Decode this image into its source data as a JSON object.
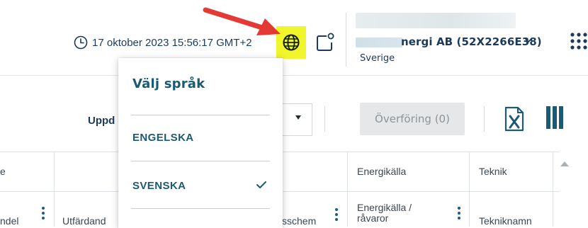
{
  "header": {
    "datetime": "17 oktober 2023 15:56:17 GMT+2",
    "account_name": "nergi AB (52X2266E38)",
    "account_country": "Sverige",
    "highlight_color": "#f1f52c",
    "arrow_color": "#e53935",
    "icons": {
      "clock": "clock-icon",
      "language": "globe-icon",
      "export": "external-window-icon",
      "account_menu": "chevron-down-icon",
      "apps": "grid-menu-icon"
    }
  },
  "toolbar": {
    "update_label": "Uppd",
    "transfer_label": "Överföring (0)",
    "icons": {
      "excel": "excel-export-icon",
      "columns": "columns-icon"
    }
  },
  "table": {
    "headers": [
      "e",
      "Energikälla",
      "Teknik"
    ],
    "row1": [
      "ndel",
      "Utfärdand",
      "sschem",
      "Energikälla / råvaror",
      "Tekniknamn"
    ]
  },
  "language_menu": {
    "title": "Välj språk",
    "items": [
      {
        "label": "ENGELSKA",
        "selected": false
      },
      {
        "label": "SVENSKA",
        "selected": true
      }
    ]
  }
}
